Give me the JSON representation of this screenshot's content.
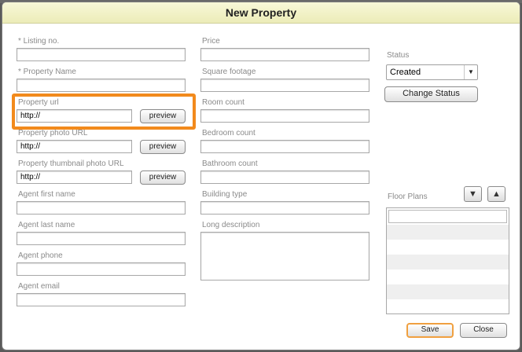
{
  "dialog": {
    "title": "New Property"
  },
  "form": {
    "listing_no_label": "* Listing no.",
    "property_name_label": "* Property Name",
    "property_url_label": "Property url",
    "property_url_value": "http://",
    "photo_url_label": "Property photo URL",
    "photo_url_value": "http://",
    "thumb_url_label": "Property thumbnail photo URL",
    "thumb_url_value": "http://",
    "agent_first_label": "Agent first name",
    "agent_last_label": "Agent last name",
    "agent_phone_label": "Agent phone",
    "agent_email_label": "Agent email",
    "price_label": "Price",
    "square_footage_label": "Square footage",
    "room_count_label": "Room count",
    "bedroom_count_label": "Bedroom count",
    "bathroom_count_label": "Bathroom count",
    "building_type_label": "Building type",
    "long_description_label": "Long description",
    "preview_label": "preview"
  },
  "status": {
    "label": "Status",
    "selected": "Created",
    "change_button": "Change Status"
  },
  "floor_plans": {
    "label": "Floor Plans"
  },
  "footer": {
    "save_label": "Save",
    "close_label": "Close"
  },
  "colors": {
    "highlight": "#f28a1c",
    "save_border": "#f0a040"
  }
}
